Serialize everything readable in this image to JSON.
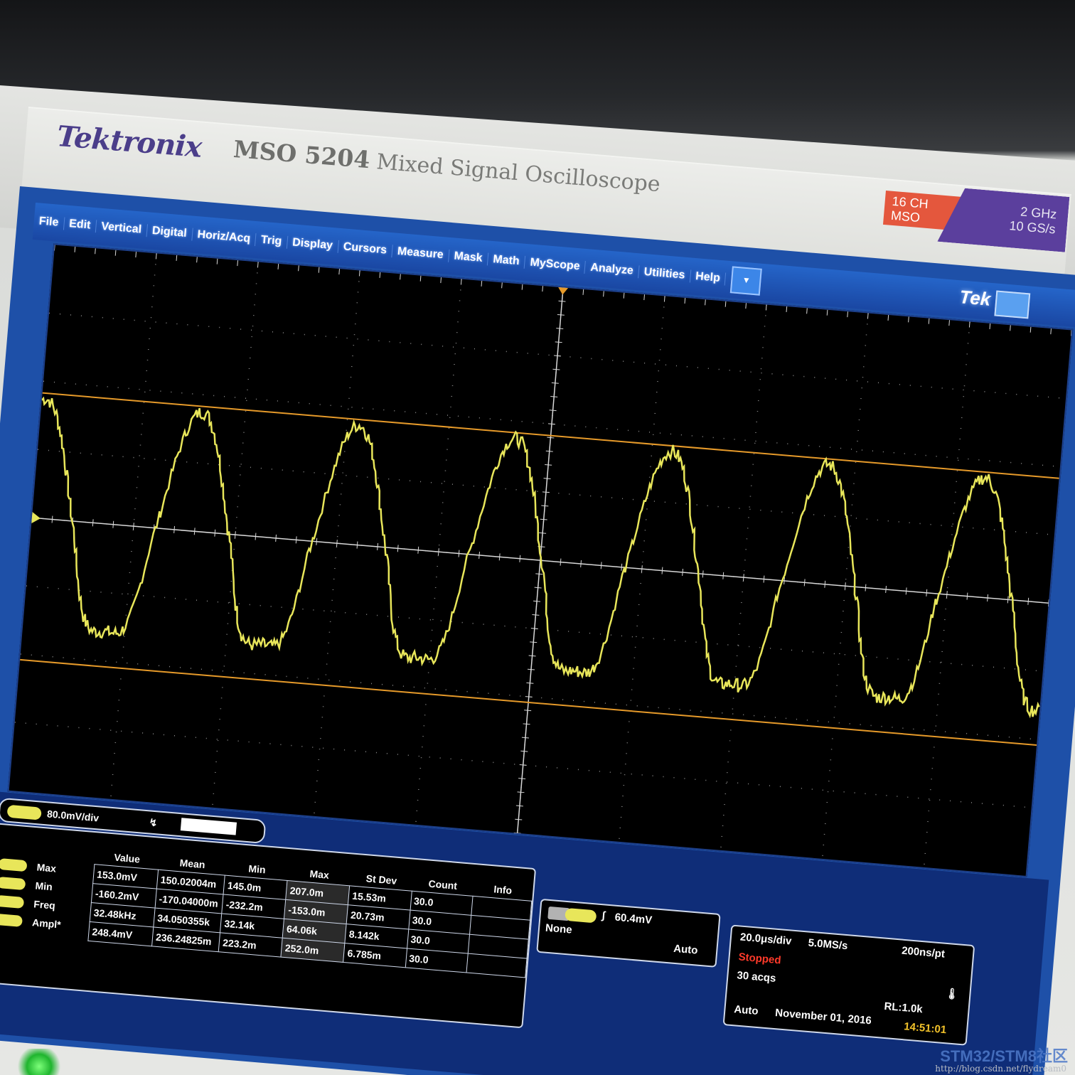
{
  "device": {
    "brand": "Tektronix",
    "model_number": "MSO 5204",
    "model_desc": "Mixed Signal Oscilloscope",
    "badge_channels_line1": "16 CH",
    "badge_channels_line2": "MSO",
    "badge_bandwidth": "2 GHz",
    "badge_rate": "10 GS/s"
  },
  "menu": {
    "items": [
      "File",
      "Edit",
      "Vertical",
      "Digital",
      "Horiz/Acq",
      "Trig",
      "Display",
      "Cursors",
      "Measure",
      "Mask",
      "Math",
      "MyScope",
      "Analyze",
      "Utilities",
      "Help"
    ],
    "dropdown_icon": "chevron-down-icon",
    "logo": "Tek"
  },
  "channel": {
    "scale": "80.0mV/div"
  },
  "measurements": {
    "labels": [
      "Max",
      "Min",
      "Freq",
      "Ampl*"
    ],
    "headers": [
      "Value",
      "Mean",
      "Min",
      "Max",
      "St Dev",
      "Count",
      "Info"
    ],
    "rows": [
      [
        "153.0mV",
        "150.02004m",
        "145.0m",
        "207.0m",
        "15.53m",
        "30.0",
        ""
      ],
      [
        "-160.2mV",
        "-170.04000m",
        "-232.2m",
        "-153.0m",
        "20.73m",
        "30.0",
        ""
      ],
      [
        "32.48kHz",
        "34.050355k",
        "32.14k",
        "64.06k",
        "8.142k",
        "30.0",
        ""
      ],
      [
        "248.4mV",
        "236.24825m",
        "223.2m",
        "252.0m",
        "6.785m",
        "30.0",
        ""
      ]
    ]
  },
  "trigger": {
    "level": "60.4mV",
    "coupling": "None",
    "mode": "Auto"
  },
  "acquisition": {
    "timebase": "20.0μs/div",
    "sample_rate": "5.0MS/s",
    "resolution": "200ns/pt",
    "state": "Stopped",
    "acqs": "30 acqs",
    "record_length": "RL:1.0k",
    "mode": "Auto",
    "date": "November 01, 2016",
    "time": "14:51:01"
  },
  "colors": {
    "trace": "#e8e65a",
    "cursor": "#e69a2a",
    "accent": "#1a47a3"
  },
  "watermark": {
    "brand": "STM32/STM8社区",
    "url": "http://blog.csdn.net/flydream0"
  }
}
